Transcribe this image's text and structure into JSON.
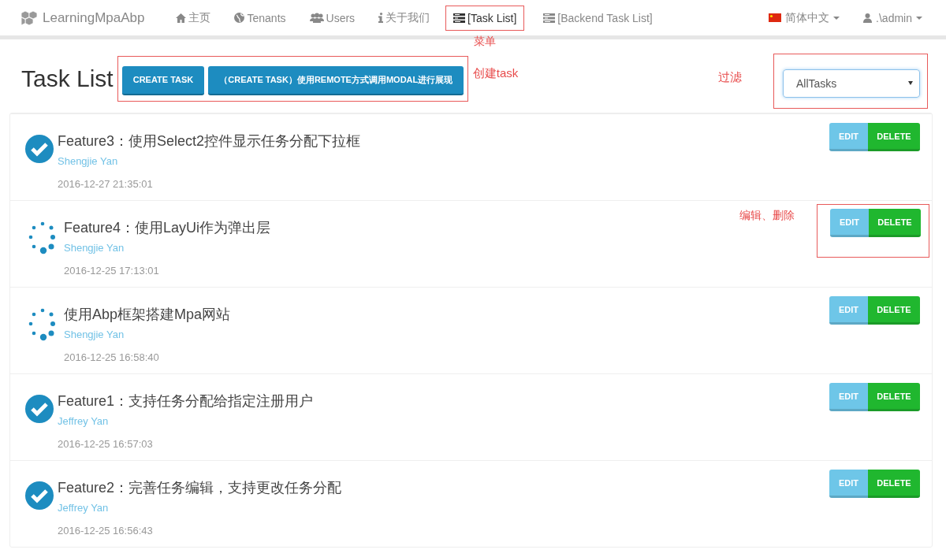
{
  "navbar": {
    "brand": "LearningMpaAbp",
    "items": [
      {
        "label": "主页",
        "kind": "home",
        "selected": false
      },
      {
        "label": "Tenants",
        "kind": "globe",
        "selected": false
      },
      {
        "label": "Users",
        "kind": "users",
        "selected": false
      },
      {
        "label": "关于我们",
        "kind": "info",
        "selected": false
      },
      {
        "label": "[Task List]",
        "kind": "list",
        "selected": true,
        "annotation": "菜单"
      },
      {
        "label": "[Backend Task List]",
        "kind": "list",
        "selected": false
      }
    ],
    "language": "简体中文",
    "user": ".\\admin"
  },
  "header": {
    "title": "Task List",
    "buttons": [
      "CREATE TASK",
      "（CREATE TASK）使用REMOTE方式调用MODAL进行展现"
    ],
    "buttons_annotation": "创建task",
    "filter": {
      "value": "AllTasks",
      "annotation": "过滤"
    }
  },
  "tasks": [
    {
      "title": "Feature3：使用Select2控件显示任务分配下拉框",
      "assignee": "Shengjie Yan",
      "time": "2016-12-27 21:35:01",
      "kind": "completed",
      "actions": [
        "EDIT",
        "DELETE"
      ]
    },
    {
      "title": "Feature4：使用LayUi作为弹出层",
      "assignee": "Shengjie Yan",
      "time": "2016-12-25 17:13:01",
      "kind": "active",
      "actions": [
        "EDIT",
        "DELETE"
      ],
      "actions_annotation": "编辑、删除"
    },
    {
      "title": "使用Abp框架搭建Mpa网站",
      "assignee": "Shengjie Yan",
      "time": "2016-12-25 16:58:40",
      "kind": "active",
      "actions": [
        "EDIT",
        "DELETE"
      ]
    },
    {
      "title": "Feature1：支持任务分配给指定注册用户",
      "assignee": "Jeffrey Yan",
      "time": "2016-12-25 16:57:03",
      "kind": "completed",
      "actions": [
        "EDIT",
        "DELETE"
      ]
    },
    {
      "title": "Feature2：完善任务编辑，支持更改任务分配",
      "assignee": "Jeffrey Yan",
      "time": "2016-12-25 16:56:43",
      "kind": "completed",
      "actions": [
        "EDIT",
        "DELETE"
      ]
    }
  ]
}
